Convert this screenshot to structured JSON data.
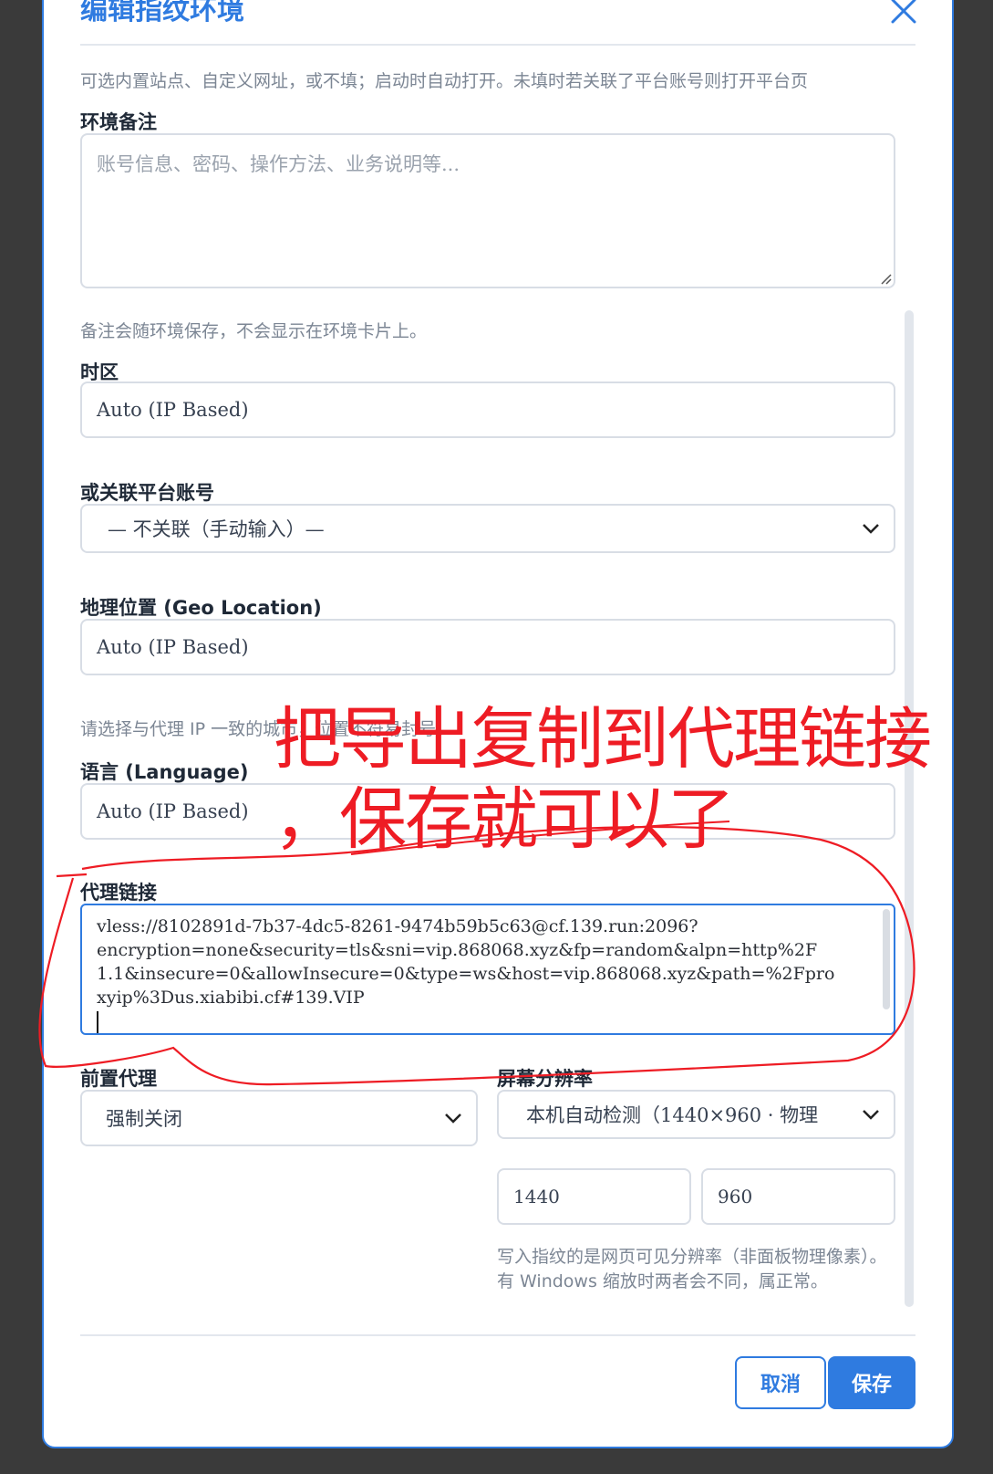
{
  "modal": {
    "title": "编辑指纹环境"
  },
  "url_hint": "可选内置站点、自定义网址，或不填；启动时自动打开。未填时若关联了平台账号则打开平台页",
  "notes": {
    "label": "环境备注",
    "placeholder": "账号信息、密码、操作方法、业务说明等...",
    "hint": "备注会随环境保存，不会显示在环境卡片上。"
  },
  "timezone": {
    "label": "时区",
    "value": "Auto (IP Based)"
  },
  "platform_account": {
    "label": "或关联平台账号",
    "value": "— 不关联（手动输入）—"
  },
  "geo": {
    "label": "地理位置 (Geo Location)",
    "value": "Auto (IP Based)",
    "hint": "请选择与代理 IP 一致的城市，位置不符易封号。"
  },
  "language": {
    "label": "语言 (Language)",
    "value": "Auto (IP Based)"
  },
  "proxy": {
    "label": "代理链接",
    "lines": [
      "vless://8102891d-7b37-4dc5-8261-9474b59b5c63@cf.139.run:2096?",
      "encryption=none&security=tls&sni=vip.868068.xyz&fp=random&alpn=http%2F",
      "1.1&insecure=0&allowInsecure=0&type=ws&host=vip.868068.xyz&path=%2Fpro",
      "xyip%3Dus.xiabibi.cf#139.VIP"
    ]
  },
  "front_proxy": {
    "label": "前置代理",
    "value": "强制关闭"
  },
  "resolution": {
    "label": "屏幕分辨率",
    "value": "本机自动检测（1440×960 · 物理",
    "width": "1440",
    "height": "960",
    "hint": "写入指纹的是网页可见分辨率（非面板物理像素）。有 Windows 缩放时两者会不同，属正常。"
  },
  "buttons": {
    "cancel": "取消",
    "save": "保存"
  },
  "annotation": {
    "line1": "把导出复制到代理链接",
    "line2": "，保存就可以了"
  },
  "colors": {
    "accent": "#2f7be0",
    "annotation": "#ee1c24"
  }
}
